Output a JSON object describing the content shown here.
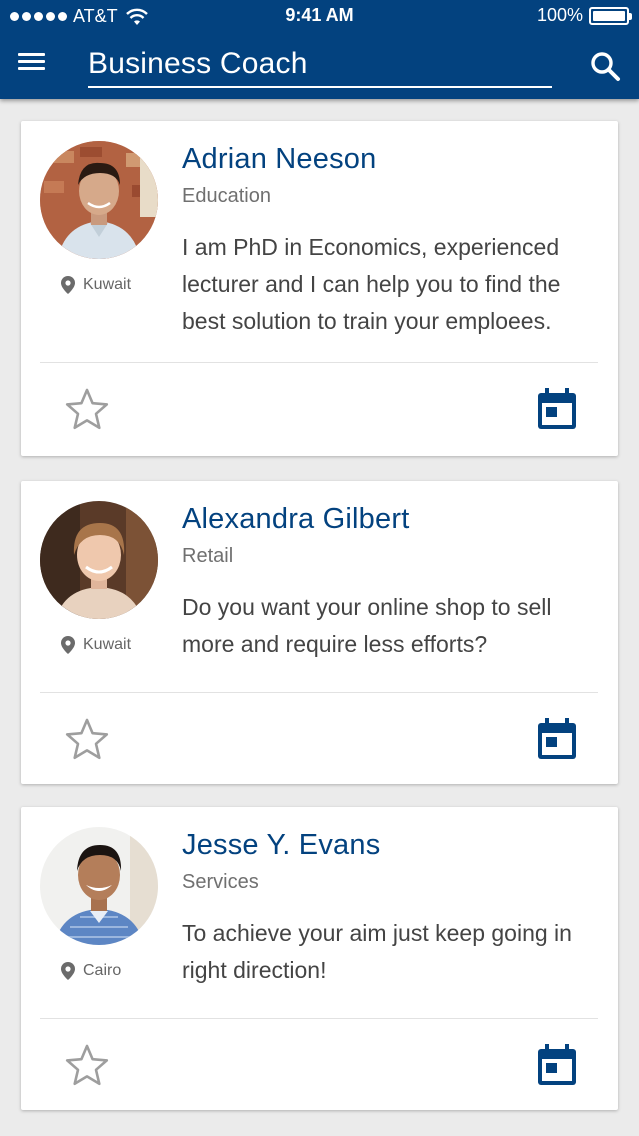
{
  "status_bar": {
    "carrier": "AT&T",
    "time": "9:41 AM",
    "battery": "100%"
  },
  "app_bar": {
    "search_value": "Business Coach",
    "menu_icon": "hamburger-menu-icon",
    "search_icon": "search-icon"
  },
  "colors": {
    "primary": "#03427f",
    "background": "#ebebeb",
    "card": "#ffffff",
    "icon_inactive": "#9e9e9e"
  },
  "coaches": [
    {
      "name": "Adrian Neeson",
      "category": "Education",
      "location": "Kuwait",
      "description": "I am PhD in Economics, experienced lecturer and I can help you to find the best solution to train your emploees."
    },
    {
      "name": "Alexandra Gilbert",
      "category": "Retail",
      "location": "Kuwait",
      "description": "Do you want your online shop to sell more and require less efforts?"
    },
    {
      "name": "Jesse Y. Evans",
      "category": "Services",
      "location": "Cairo",
      "description": "To achieve your aim just keep going in right direction!"
    }
  ]
}
